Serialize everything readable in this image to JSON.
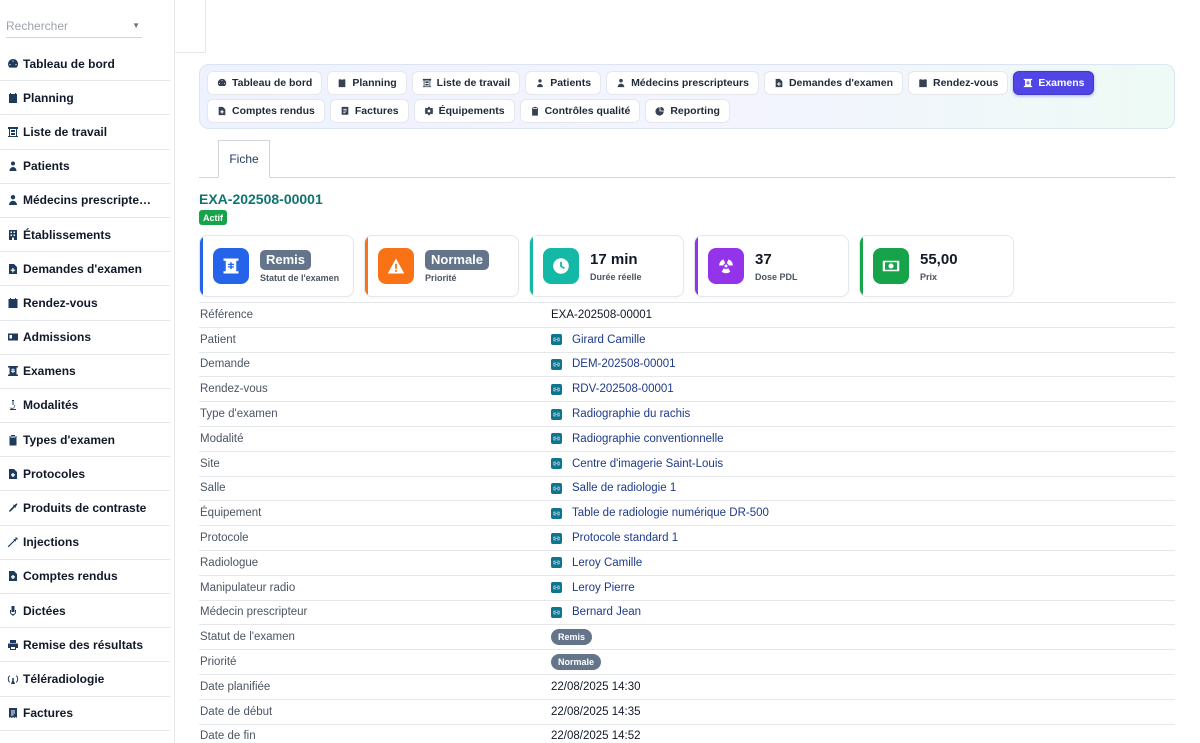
{
  "search": {
    "placeholder": "Rechercher"
  },
  "sidebar": {
    "items": [
      {
        "label": "Tableau de bord",
        "icon": "gauge-icon"
      },
      {
        "label": "Planning",
        "icon": "calendar-icon"
      },
      {
        "label": "Liste de travail",
        "icon": "worklist-icon"
      },
      {
        "label": "Patients",
        "icon": "user-icon"
      },
      {
        "label": "Médecins prescripte…",
        "icon": "doctor-icon"
      },
      {
        "label": "Établissements",
        "icon": "building-icon"
      },
      {
        "label": "Demandes d'examen",
        "icon": "file-plus-icon"
      },
      {
        "label": "Rendez-vous",
        "icon": "calendar-check-icon"
      },
      {
        "label": "Admissions",
        "icon": "id-card-icon"
      },
      {
        "label": "Examens",
        "icon": "xray-icon"
      },
      {
        "label": "Modalités",
        "icon": "microscope-icon"
      },
      {
        "label": "Types d'examen",
        "icon": "clipboard-icon"
      },
      {
        "label": "Protocoles",
        "icon": "file-medical-icon"
      },
      {
        "label": "Produits de contraste",
        "icon": "eyedropper-icon"
      },
      {
        "label": "Injections",
        "icon": "syringe-icon"
      },
      {
        "label": "Comptes rendus",
        "icon": "file-medical-icon"
      },
      {
        "label": "Dictées",
        "icon": "microphone-icon"
      },
      {
        "label": "Remise des résultats",
        "icon": "printer-icon"
      },
      {
        "label": "Téléradiologie",
        "icon": "broadcast-icon"
      },
      {
        "label": "Factures",
        "icon": "invoice-icon"
      }
    ]
  },
  "tabs": [
    {
      "label": "Tableau de bord",
      "active": false
    },
    {
      "label": "Planning",
      "active": false
    },
    {
      "label": "Liste de travail",
      "active": false
    },
    {
      "label": "Patients",
      "active": false
    },
    {
      "label": "Médecins prescripteurs",
      "active": false
    },
    {
      "label": "Demandes d'examen",
      "active": false
    },
    {
      "label": "Rendez-vous",
      "active": false
    },
    {
      "label": "Examens",
      "active": true
    },
    {
      "label": "Comptes rendus",
      "active": false
    },
    {
      "label": "Factures",
      "active": false
    },
    {
      "label": "Équipements",
      "active": false
    },
    {
      "label": "Contrôles qualité",
      "active": false
    },
    {
      "label": "Reporting",
      "active": false
    }
  ],
  "subtab": {
    "label": "Fiche"
  },
  "record": {
    "title": "EXA-202508-00001",
    "status_badge": "Actif"
  },
  "cards": [
    {
      "value": "Remis",
      "label": "Statut de l'examen",
      "color": "#2563eb",
      "pill": true,
      "icon": "xray-icon"
    },
    {
      "value": "Normale",
      "label": "Priorité",
      "color": "#f97316",
      "pill": true,
      "icon": "warning-icon"
    },
    {
      "value": "17 min",
      "label": "Durée réelle",
      "color": "#14b8a6",
      "pill": false,
      "icon": "clock-icon"
    },
    {
      "value": "37",
      "label": "Dose PDL",
      "color": "#9333ea",
      "pill": false,
      "icon": "radiation-icon"
    },
    {
      "value": "55,00",
      "label": "Prix",
      "color": "#16a34a",
      "pill": false,
      "icon": "money-icon"
    }
  ],
  "details": [
    {
      "label": "Référence",
      "value": "EXA-202508-00001",
      "type": "text"
    },
    {
      "label": "Patient",
      "value": "Girard Camille",
      "type": "link"
    },
    {
      "label": "Demande",
      "value": "DEM-202508-00001",
      "type": "link"
    },
    {
      "label": "Rendez-vous",
      "value": "RDV-202508-00001",
      "type": "link"
    },
    {
      "label": "Type d'examen",
      "value": "Radiographie du rachis",
      "type": "link"
    },
    {
      "label": "Modalité",
      "value": "Radiographie conventionnelle",
      "type": "link"
    },
    {
      "label": "Site",
      "value": "Centre d'imagerie Saint-Louis",
      "type": "link"
    },
    {
      "label": "Salle",
      "value": "Salle de radiologie 1",
      "type": "link"
    },
    {
      "label": "Équipement",
      "value": "Table de radiologie numérique DR-500",
      "type": "link"
    },
    {
      "label": "Protocole",
      "value": "Protocole standard 1",
      "type": "link"
    },
    {
      "label": "Radiologue",
      "value": "Leroy Camille",
      "type": "link"
    },
    {
      "label": "Manipulateur radio",
      "value": "Leroy Pierre",
      "type": "link"
    },
    {
      "label": "Médecin prescripteur",
      "value": "Bernard Jean",
      "type": "link"
    },
    {
      "label": "Statut de l'examen",
      "value": "Remis",
      "type": "pill"
    },
    {
      "label": "Priorité",
      "value": "Normale",
      "type": "pill"
    },
    {
      "label": "Date planifiée",
      "value": "22/08/2025 14:30",
      "type": "text"
    },
    {
      "label": "Date de début",
      "value": "22/08/2025 14:35",
      "type": "text"
    },
    {
      "label": "Date de fin",
      "value": "22/08/2025 14:52",
      "type": "text"
    }
  ]
}
